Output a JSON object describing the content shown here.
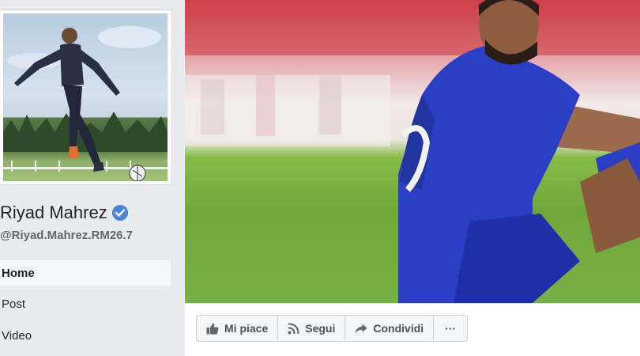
{
  "profile": {
    "name": "Riyad Mahrez",
    "handle": "@Riyad.Mahrez.RM26.7",
    "verified": true
  },
  "sidebar": {
    "items": [
      {
        "label": "Home",
        "active": true
      },
      {
        "label": "Post",
        "active": false
      },
      {
        "label": "Video",
        "active": false
      }
    ]
  },
  "actions": {
    "like_label": "Mi piace",
    "follow_label": "Segui",
    "share_label": "Condividi",
    "more_label": "···"
  },
  "icons": {
    "verified": "verified-check-icon",
    "like": "thumbs-up-icon",
    "follow": "rss-icon",
    "share": "share-arrow-icon"
  },
  "colors": {
    "background": "#e9ebee",
    "verified_blue": "#4c84d8",
    "jersey_blue": "#2a3fc4"
  }
}
